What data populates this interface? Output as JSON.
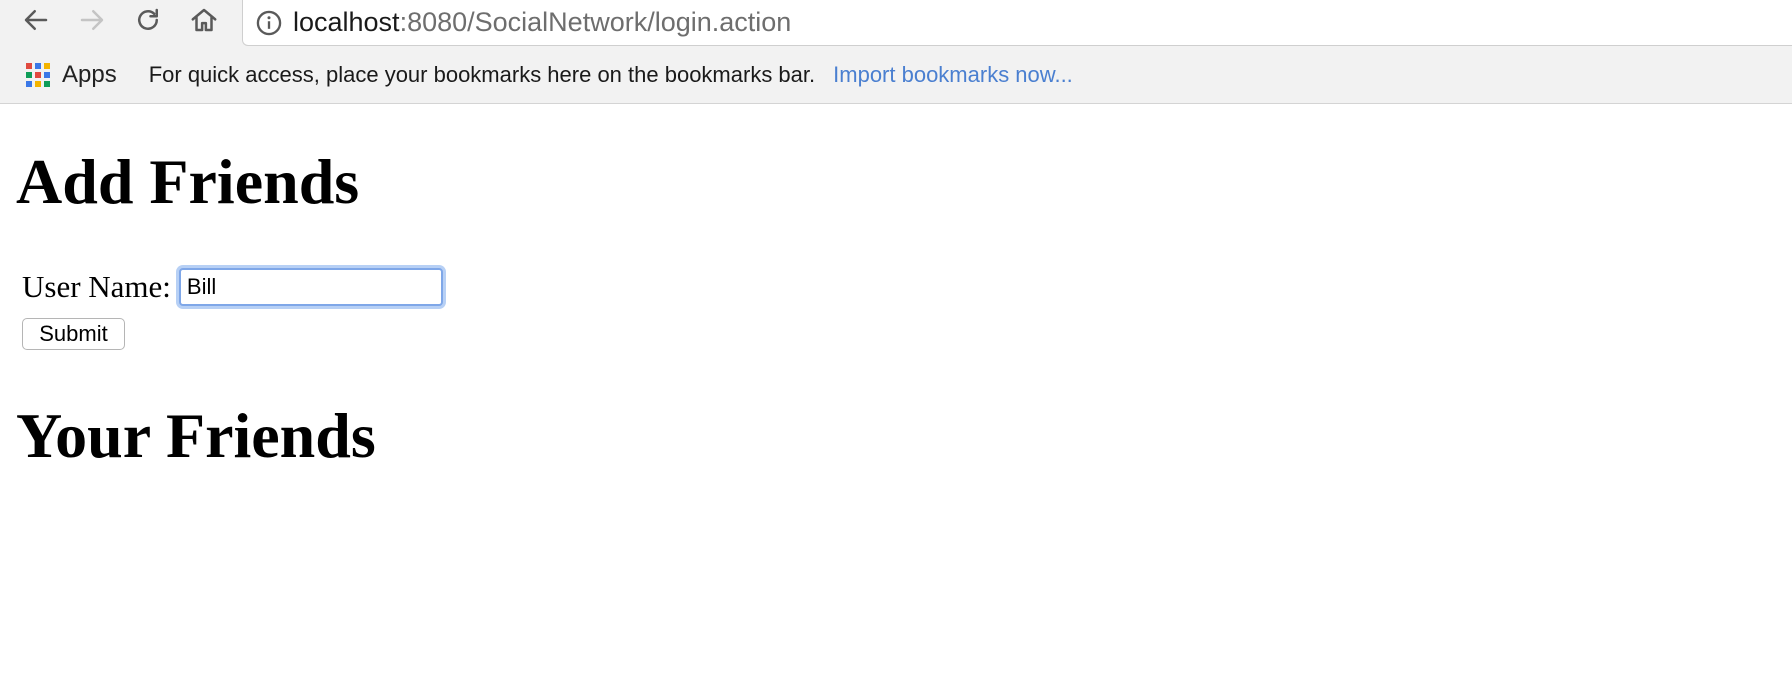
{
  "toolbar": {
    "back_icon": "arrow-left-icon",
    "forward_icon": "arrow-right-icon",
    "reload_icon": "reload-icon",
    "home_icon": "home-icon",
    "address": {
      "host": "localhost",
      "rest": ":8080/SocialNetwork/login.action"
    }
  },
  "bookmarks": {
    "apps_label": "Apps",
    "hint": "For quick access, place your bookmarks here on the bookmarks bar.",
    "import_link": "Import bookmarks now..."
  },
  "page": {
    "add_heading": "Add Friends",
    "username_label": "User Name:",
    "username_value": "Bill",
    "submit_label": "Submit",
    "friends_heading": "Your Friends"
  },
  "colors": {
    "link": "#4a7fd0",
    "focus_ring": "#7fa7e8",
    "chrome_bg": "#f2f2f2"
  }
}
